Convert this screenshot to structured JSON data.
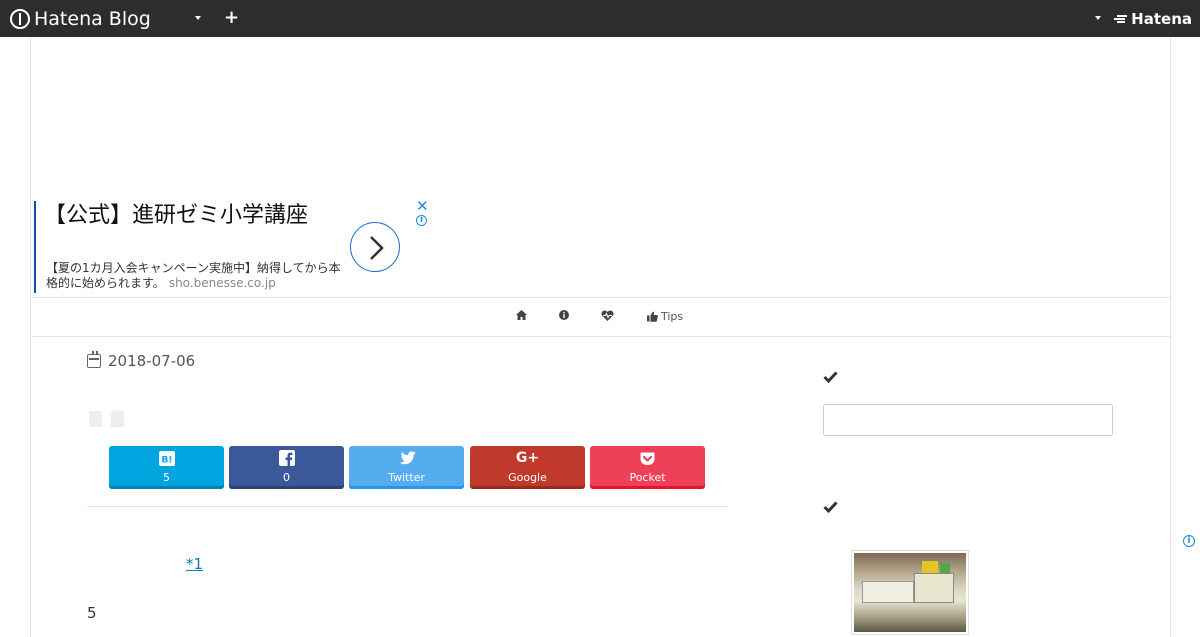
{
  "topbar": {
    "brand": "Hatena Blog",
    "right_brand": "Hatena"
  },
  "ad": {
    "title": "【公式】進研ゼミ小学講座",
    "description": "【夏の1カ月入会キャンペーン実施中】納得してから本格的に始められます。",
    "domain": "sho.benesse.co.jp",
    "close": "✕",
    "info": "i"
  },
  "global_nav": {
    "items": [
      {
        "icon": "home-icon",
        "label": ""
      },
      {
        "icon": "info-icon",
        "label": ""
      },
      {
        "icon": "heartbeat-icon",
        "label": ""
      },
      {
        "icon": "thumbs-up-icon",
        "label": "Tips"
      }
    ]
  },
  "article": {
    "date": "2018-07-06",
    "footnote": "*1",
    "body_text": "5"
  },
  "share": {
    "hatena": {
      "icon": "B!",
      "label": "5",
      "color": "#00a4de"
    },
    "facebook": {
      "icon": "f",
      "label": "0",
      "color": "#3b5998"
    },
    "twitter": {
      "icon": "twitter-bird",
      "label": "Twitter",
      "color": "#55acee"
    },
    "google": {
      "icon": "G+",
      "label": "Google",
      "color": "#c0392b"
    },
    "pocket": {
      "icon": "pocket",
      "label": "Pocket",
      "color": "#ee4056"
    }
  },
  "sidebar": {
    "search_placeholder": ""
  }
}
